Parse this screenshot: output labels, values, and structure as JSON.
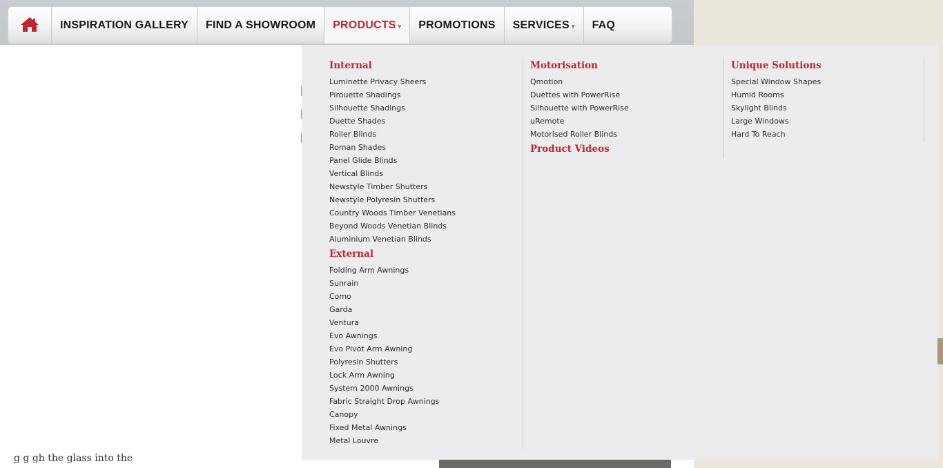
{
  "nav": {
    "items": [
      {
        "label": "INSPIRATION GALLERY",
        "has_dropdown": false,
        "active": false
      },
      {
        "label": "FIND A SHOWROOM",
        "has_dropdown": false,
        "active": false
      },
      {
        "label": "PRODUCTS",
        "has_dropdown": true,
        "active": true
      },
      {
        "label": "PROMOTIONS",
        "has_dropdown": false,
        "active": false
      },
      {
        "label": "SERVICES",
        "has_dropdown": true,
        "active": false
      },
      {
        "label": "FAQ",
        "has_dropdown": false,
        "active": false
      }
    ],
    "home_icon": "home-icon",
    "caret_glyph": "▾"
  },
  "dropdown": {
    "internal": {
      "title": "Internal",
      "items": [
        "Luminette Privacy Sheers",
        "Pirouette Shadings",
        "Silhouette Shadings",
        "Duette Shades",
        "Roller Blinds",
        "Roman Shades",
        "Panel Glide Blinds",
        "Vertical Blinds",
        "Newstyle Timber Shutters",
        "Newstyle Polyresin Shutters",
        "Country Woods Timber Venetians",
        "Beyond Woods Venetian Blinds",
        "Aluminium Venetian Blinds"
      ]
    },
    "external": {
      "title": "External",
      "items": [
        "Folding Arm Awnings",
        "Sunrain",
        "Como",
        "Garda",
        "Ventura",
        "Evo Awnings",
        "Evo Pivot Arm Awning",
        "Polyresin Shutters",
        "Lock Arm Awning",
        "System 2000 Awnings",
        "Fabric Straight Drop Awnings",
        "Canopy",
        "Fixed Metal Awnings",
        "Metal Louvre"
      ]
    },
    "motorisation": {
      "title": "Motorisation",
      "items": [
        "Qmotion",
        "Duettes with PowerRise",
        "Silhouette with PowerRise",
        "uRemote",
        "Motorised Roller Blinds"
      ]
    },
    "product_videos": {
      "title": "Product Videos"
    },
    "unique": {
      "title": "Unique Solutions",
      "items": [
        "Special Window Shapes",
        "Humid Rooms",
        "Skylight Blinds",
        "Large Windows",
        "Hard To Reach"
      ]
    }
  },
  "background": {
    "partial_text": "g g             gh the glass into the"
  },
  "colors": {
    "accent": "#c0262e",
    "dropdown_bg": "#ececee",
    "nav_text": "#1a1a1a"
  }
}
